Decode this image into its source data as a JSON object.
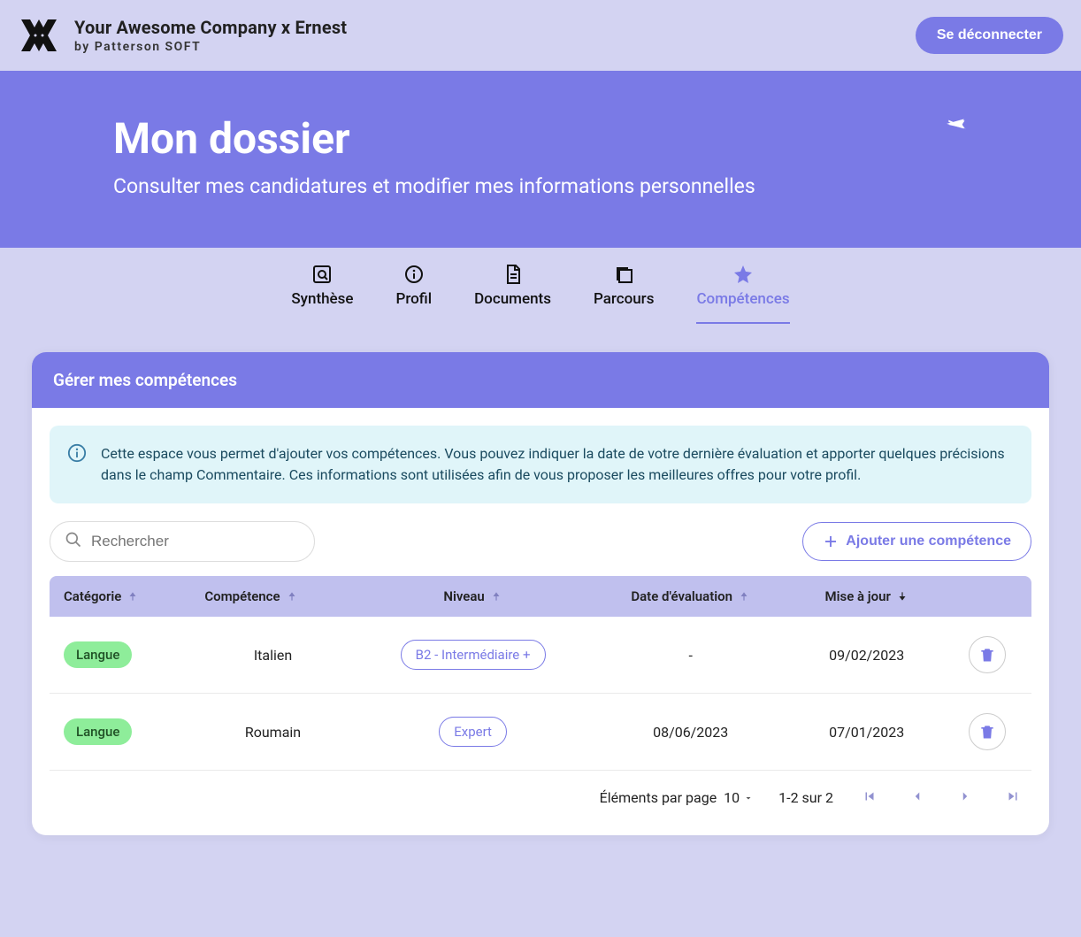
{
  "header": {
    "company_title": "Your Awesome Company x Ernest",
    "byline": "by Patterson SOFT",
    "signout_label": "Se déconnecter"
  },
  "hero": {
    "title": "Mon dossier",
    "subtitle": "Consulter mes candidatures et modifier mes informations personnelles"
  },
  "tabs": [
    {
      "label": "Synthèse"
    },
    {
      "label": "Profil"
    },
    {
      "label": "Documents"
    },
    {
      "label": "Parcours"
    },
    {
      "label": "Compétences"
    }
  ],
  "card": {
    "header": "Gérer mes compétences",
    "info_text": "Cette espace vous permet d'ajouter vos compétences. Vous pouvez indiquer la date de votre dernière évaluation et apporter quelques précisions dans le champ Commentaire. Ces informations sont utilisées afin de vous proposer les meilleures offres pour votre profil.",
    "search_placeholder": "Rechercher",
    "add_button_label": "Ajouter une compétence"
  },
  "table": {
    "columns": {
      "category": "Catégorie",
      "skill": "Compétence",
      "level": "Niveau",
      "eval_date": "Date d'évaluation",
      "updated": "Mise à jour"
    },
    "rows": [
      {
        "category": "Langue",
        "skill": "Italien",
        "level": "B2 - Intermédiaire +",
        "eval_date": "-",
        "updated": "09/02/2023"
      },
      {
        "category": "Langue",
        "skill": "Roumain",
        "level": "Expert",
        "eval_date": "08/06/2023",
        "updated": "07/01/2023"
      }
    ]
  },
  "pagination": {
    "per_page_label": "Éléments par page",
    "per_page_value": "10",
    "range_label": "1-2 sur 2"
  }
}
